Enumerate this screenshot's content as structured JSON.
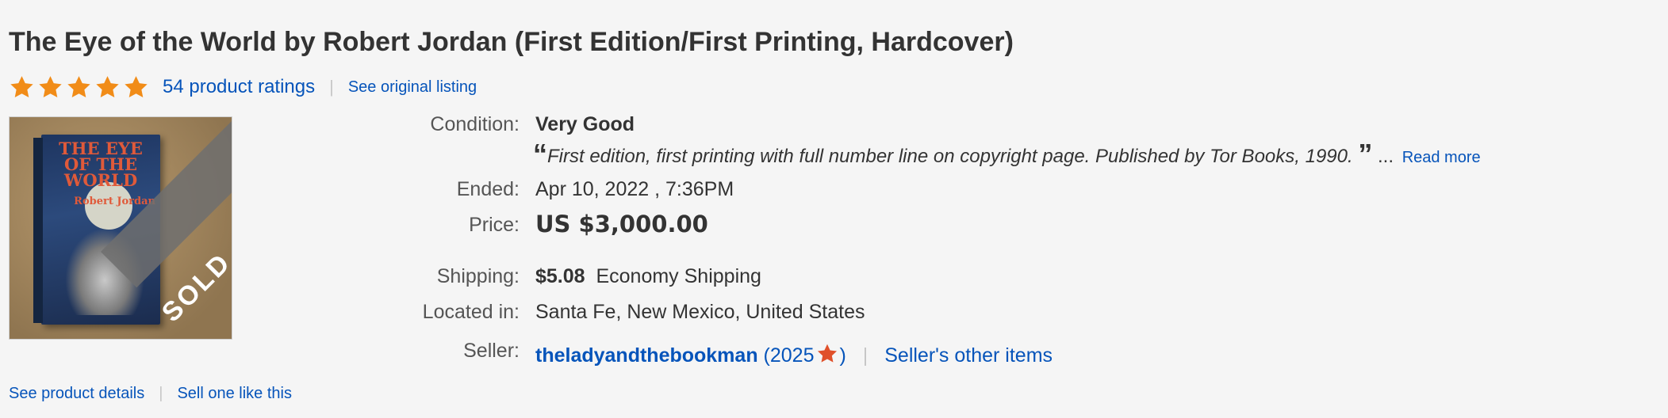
{
  "listing": {
    "title": "The Eye of the World by Robert Jordan (First Edition/First Printing, Hardcover)",
    "rating_stars": 5,
    "ratings_text": "54 product ratings",
    "see_original": "See original listing"
  },
  "image": {
    "book_title": "THE EYE OF THE WORLD",
    "book_author": "Robert Jordan",
    "sold_badge": "SOLD"
  },
  "details": {
    "condition_label": "Condition:",
    "condition_value": "Very Good",
    "description": "First edition, first printing with full number line on copyright page. Published by Tor Books, 1990.",
    "open_quote": "“",
    "close_quote": "”",
    "ellipsis": "...",
    "read_more": "Read more",
    "ended_label": "Ended:",
    "ended_value": "Apr 10, 2022 , 7:36PM",
    "price_label": "Price:",
    "price_value": "US $3,000.00",
    "shipping_label": "Shipping:",
    "shipping_amount": "$5.08",
    "shipping_method": "Economy Shipping",
    "location_label": "Located in:",
    "location_value": "Santa Fe, New Mexico, United States",
    "seller_label": "Seller:",
    "seller_name": "theladyandthebookman",
    "seller_score_open": "(2025",
    "seller_score_close": ")",
    "seller_other_items": "Seller's other items"
  },
  "footer": {
    "product_details": "See product details",
    "sell_one": "Sell one like this"
  },
  "colors": {
    "link": "#0654ba",
    "star": "#f18c18",
    "seller_star": "#e0502a"
  }
}
